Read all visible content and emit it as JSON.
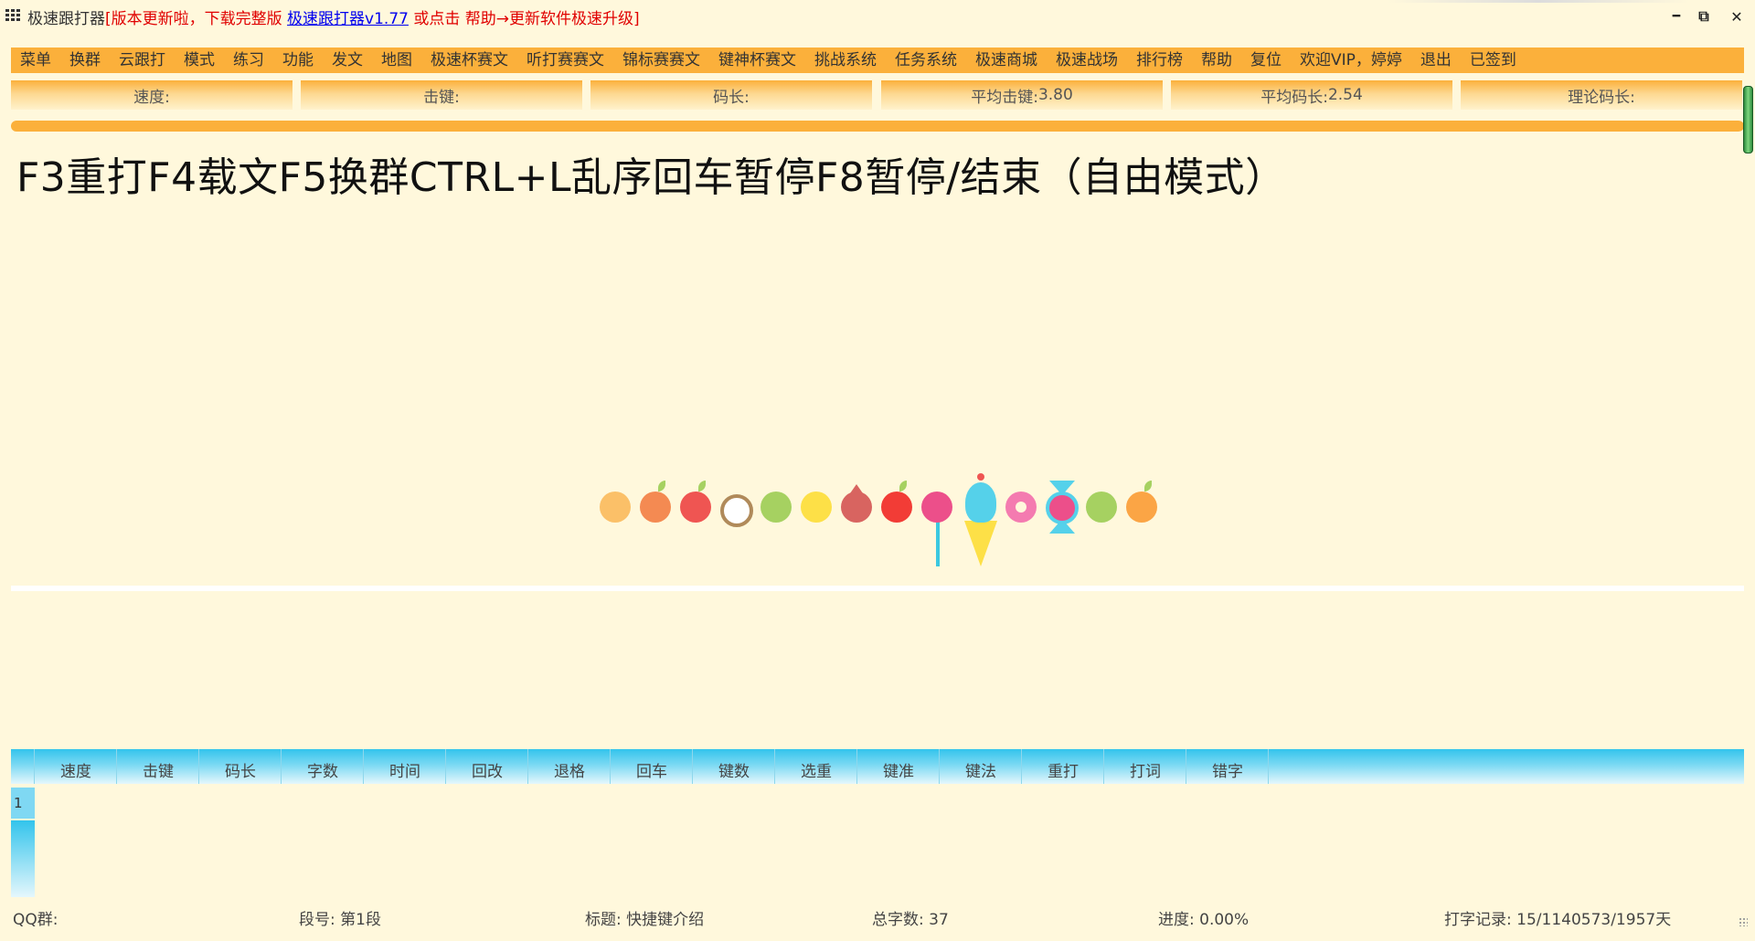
{
  "window": {
    "app_name": "极速跟打器",
    "bracket_open": "[",
    "notice": "版本更新啦，下载完整版 ",
    "link_text": "极速跟打器v1.77",
    "notice_tail": " 或点击 帮助→更新软件极速升级",
    "bracket_close": "]",
    "minimize_glyph": "━",
    "restore_glyph": "⧉",
    "close_glyph": "✕"
  },
  "menu": {
    "items": [
      "菜单",
      "换群",
      "云跟打",
      "模式",
      "练习",
      "功能",
      "发文",
      "地图",
      "极速杯赛文",
      "听打赛赛文",
      "锦标赛赛文",
      "键神杯赛文",
      "挑战系统",
      "任务系统",
      "极速商城",
      "极速战场",
      "排行榜",
      "帮助",
      "复位",
      "欢迎VIP，婷婷",
      "退出",
      "已签到"
    ]
  },
  "stats": [
    {
      "label": "速度:",
      "value": ""
    },
    {
      "label": "击键:",
      "value": ""
    },
    {
      "label": "码长:",
      "value": ""
    },
    {
      "label": "平均击键:",
      "value": "3.80"
    },
    {
      "label": "平均码长:",
      "value": "2.54"
    },
    {
      "label": "理论码长:",
      "value": ""
    }
  ],
  "article_text": "F3重打F4载文F5换群CTRL+L乱序回车暂停F8暂停/结束（自由模式）",
  "loader": {
    "icons": [
      "orange-fruit-icon",
      "peach-icon",
      "apple-icon",
      "donut-ring-icon",
      "lime-icon",
      "lemon-icon",
      "pomegranate-icon",
      "red-apple-icon",
      "lollipop-icon",
      "ice-cream-icon",
      "donut-icon",
      "candy-icon",
      "green-lime-icon",
      "orange-icon"
    ],
    "colors": [
      "#fbc068",
      "#f48a52",
      "#ef5552",
      "#ffffff",
      "#a6d161",
      "#fde047",
      "#d86460",
      "#f23c36",
      "#ec4f8a",
      "#55d1ea",
      "#f47bb0",
      "#ec4f8a",
      "#a6d161",
      "#fba545"
    ]
  },
  "table": {
    "columns": [
      "速度",
      "击键",
      "码长",
      "字数",
      "时间",
      "回改",
      "退格",
      "回车",
      "键数",
      "选重",
      "键准",
      "键法",
      "重打",
      "打词",
      "错字"
    ],
    "rows": [
      [
        "1"
      ]
    ]
  },
  "status": {
    "qq_label": "QQ群:",
    "qq_value": "",
    "segment_label": "段号:",
    "segment_value": " 第1段",
    "title_label": "标题:",
    "title_value": " 快捷键介绍",
    "total_label": "总字数:",
    "total_value": " 37",
    "progress_label": "进度:",
    "progress_value": " 0.00%",
    "record_label": "打字记录:",
    "record_value": " 15/1140573/1957天"
  },
  "colors": {
    "background": "#fff8dc",
    "menu_orange": "#fbb03b",
    "table_blue": "#33c4ec",
    "notice_red": "#e00000",
    "link_blue": "#0000ee"
  }
}
